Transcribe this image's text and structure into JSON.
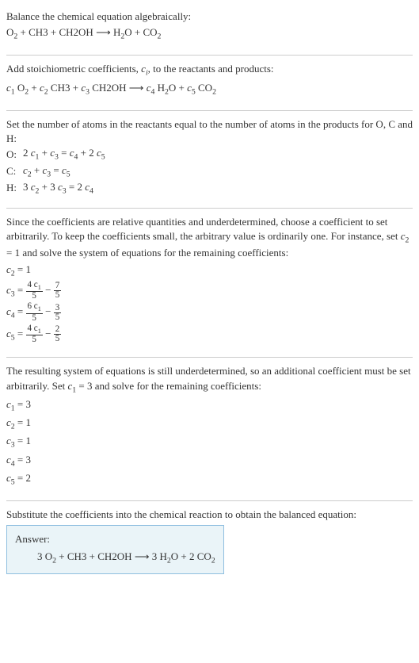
{
  "chart_data": {
    "type": "table",
    "title": "Balance the chemical equation algebraically",
    "reactants": [
      "O2",
      "CH3",
      "CH2OH"
    ],
    "products": [
      "H2O",
      "CO2"
    ],
    "atom_equations": [
      {
        "element": "O",
        "lhs": "2 c1 + c3",
        "rhs": "c4 + 2 c5"
      },
      {
        "element": "C",
        "lhs": "c2 + c3",
        "rhs": "c5"
      },
      {
        "element": "H",
        "lhs": "3 c2 + 3 c3",
        "rhs": "2 c4"
      }
    ],
    "parametric_solution_given_c2_1": {
      "c2": "1",
      "c3": "4 c1 / 5 - 7/5",
      "c4": "6 c1 / 5 - 3/5",
      "c5": "4 c1 / 5 - 2/5"
    },
    "final_coefficients": {
      "c1": 3,
      "c2": 1,
      "c3": 1,
      "c4": 3,
      "c5": 2
    },
    "balanced_equation": "3 O2 + CH3 + CH2OH -> 3 H2O + 2 CO2"
  },
  "s1": {
    "l1": "Balance the chemical equation algebraically:",
    "eq_o2": "O",
    "eq_ch3": " + CH3 + CH2OH  ⟶  H",
    "eq_h2o_o": "O + CO"
  },
  "s2": {
    "l1_a": "Add stoichiometric coefficients, ",
    "l1_c": "c",
    "l1_i": "i",
    "l1_b": ", to the reactants and products:",
    "t_c1": "c",
    "n1": "1",
    "sp1": " O",
    "sub2a": "2",
    "plus1": " + ",
    "t_c2": "c",
    "n2": "2",
    "ch3": " CH3 + ",
    "t_c3": "c",
    "n3": "3",
    "ch2oh": " CH2OH  ⟶  ",
    "t_c4": "c",
    "n4": "4",
    "h2o": " H",
    "sub2b": "2",
    "ox": "O + ",
    "t_c5": "c",
    "n5": "5",
    "co2": " CO",
    "sub2c": "2"
  },
  "s3": {
    "l1": "Set the number of atoms in the reactants equal to the number of atoms in the products for O, C and H:",
    "rO_lab": "O:",
    "rO_eq_a": "2 ",
    "rO_c1": "c",
    "rO_1": "1",
    "rO_plus": " + ",
    "rO_c3": "c",
    "rO_3": "3",
    "rO_eq": " = ",
    "rO_c4": "c",
    "rO_4": "4",
    "rO_plus2": " + 2 ",
    "rO_c5": "c",
    "rO_5": "5",
    "rC_lab": "C:",
    "rC_c2": "c",
    "rC_2": "2",
    "rC_plus": " + ",
    "rC_c3": "c",
    "rC_3": "3",
    "rC_eq": " = ",
    "rC_c5": "c",
    "rC_5": "5",
    "rH_lab": "H:",
    "rH_a": "3 ",
    "rH_c2": "c",
    "rH_2": "2",
    "rH_plus": " + 3 ",
    "rH_c3": "c",
    "rH_3": "3",
    "rH_eq": " = 2 ",
    "rH_c4": "c",
    "rH_4": "4"
  },
  "s4": {
    "l1": "Since the coefficients are relative quantities and underdetermined, choose a coefficient to set arbitrarily. To keep the coefficients small, the arbitrary value is ordinarily one. For instance, set ",
    "l1c": "c",
    "l1_2": "2",
    "l1b": " = 1 and solve the system of equations for the remaining coefficients:",
    "e1_c": "c",
    "e1_2": "2",
    "e1_rest": " = 1",
    "e2_c": "c",
    "e2_3": "3",
    "e2_eq": " = ",
    "e2_num": "4 c",
    "e2_num1": "1",
    "e2_den": "5",
    "e2_minus": " − ",
    "e2_num2": "7",
    "e2_den2": "5",
    "e3_c": "c",
    "e3_4": "4",
    "e3_eq": " = ",
    "e3_num": "6 c",
    "e3_num1": "1",
    "e3_den": "5",
    "e3_minus": " − ",
    "e3_num2": "3",
    "e3_den2": "5",
    "e4_c": "c",
    "e4_5": "5",
    "e4_eq": " = ",
    "e4_num": "4 c",
    "e4_num1": "1",
    "e4_den": "5",
    "e4_minus": " − ",
    "e4_num2": "2",
    "e4_den2": "5"
  },
  "s5": {
    "l1": "The resulting system of equations is still underdetermined, so an additional coefficient must be set arbitrarily. Set ",
    "l1c": "c",
    "l1_1": "1",
    "l1b": " = 3 and solve for the remaining coefficients:",
    "r1_c": "c",
    "r1_1": "1",
    "r1_v": " = 3",
    "r2_c": "c",
    "r2_2": "2",
    "r2_v": " = 1",
    "r3_c": "c",
    "r3_3": "3",
    "r3_v": " = 1",
    "r4_c": "c",
    "r4_4": "4",
    "r4_v": " = 3",
    "r5_c": "c",
    "r5_5": "5",
    "r5_v": " = 2"
  },
  "s6": {
    "l1": "Substitute the coefficients into the chemical reaction to obtain the balanced equation:",
    "ans_label": "Answer:",
    "eq_a": "3 O",
    "eq_2a": "2",
    "eq_b": " + CH3 + CH2OH  ⟶  3 H",
    "eq_2b": "2",
    "eq_c": "O + 2 CO",
    "eq_2c": "2"
  }
}
